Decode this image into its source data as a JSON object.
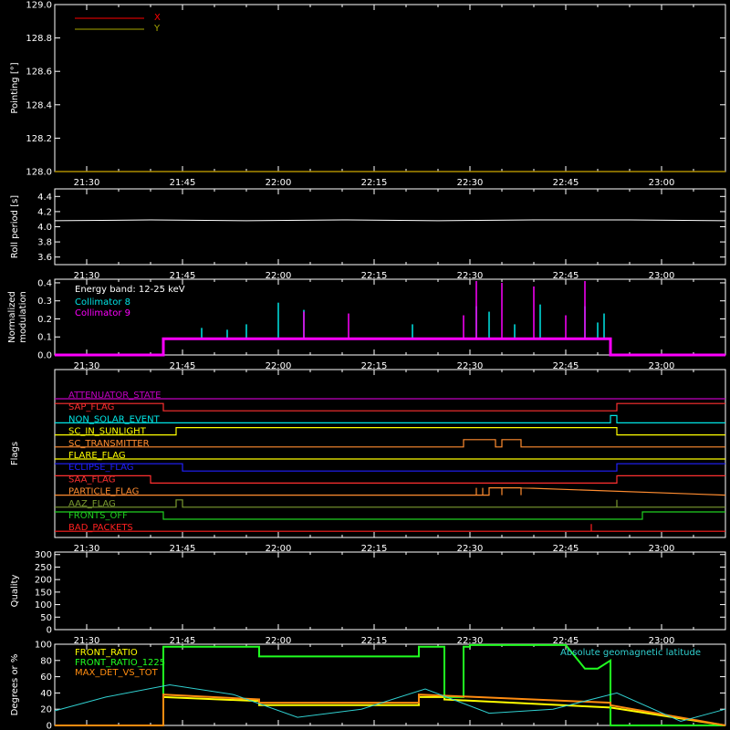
{
  "chart_data": [
    {
      "id": "pointing",
      "type": "line",
      "ylabel": "Pointing [°]",
      "ylim": [
        128.0,
        129.0
      ],
      "yticks": [
        "128.0",
        "128.2",
        "128.4",
        "128.6",
        "128.8",
        "129.0"
      ],
      "legend": [
        "X",
        "Y"
      ],
      "series": [
        {
          "name": "X",
          "color": "#ff0000",
          "x": [
            "21:25",
            "23:10"
          ],
          "y": [
            128.0,
            128.0
          ]
        },
        {
          "name": "Y",
          "color": "#a8a800",
          "x": [
            "21:25",
            "23:10"
          ],
          "y": [
            128.0,
            128.0
          ]
        }
      ]
    },
    {
      "id": "roll",
      "type": "line",
      "ylabel": "Roll period [s]",
      "ylim": [
        3.5,
        4.5
      ],
      "yticks": [
        "3.6",
        "3.8",
        "4.0",
        "4.2",
        "4.4"
      ],
      "series": [
        {
          "name": "",
          "color": "#ffffff",
          "x": [
            "21:25",
            "21:40",
            "21:55",
            "22:10",
            "22:25",
            "22:40",
            "22:55",
            "23:10"
          ],
          "y": [
            4.08,
            4.09,
            4.08,
            4.09,
            4.08,
            4.09,
            4.09,
            4.08
          ]
        }
      ]
    },
    {
      "id": "modulation",
      "type": "line",
      "ylabel": [
        "Normalized",
        "modulation"
      ],
      "ylim": [
        0,
        0.42
      ],
      "yticks": [
        "0.0",
        "0.1",
        "0.2",
        "0.3",
        "0.4"
      ],
      "annotation": "Energy band: 12-25 keV",
      "legend": [
        "Collimator 8",
        "Collimator 9"
      ],
      "series": [
        {
          "name": "Collimator 8",
          "color": "#00e5e5",
          "x": [
            "21:25",
            "21:42",
            "21:42",
            "22:52",
            "22:52",
            "23:10"
          ],
          "y": [
            0.0,
            0.0,
            0.09,
            0.09,
            0.0,
            0.0
          ],
          "spikes": [
            [
              "21:48",
              0.15
            ],
            [
              "21:52",
              0.14
            ],
            [
              "21:55",
              0.17
            ],
            [
              "22:00",
              0.29
            ],
            [
              "22:04",
              0.25
            ],
            [
              "22:21",
              0.17
            ],
            [
              "22:31",
              0.27
            ],
            [
              "22:33",
              0.24
            ],
            [
              "22:37",
              0.17
            ],
            [
              "22:41",
              0.28
            ],
            [
              "22:48",
              0.27
            ],
            [
              "22:50",
              0.18
            ],
            [
              "22:51",
              0.23
            ]
          ]
        },
        {
          "name": "Collimator 9",
          "color": "#ff00ff",
          "x": [
            "21:25",
            "21:42",
            "21:42",
            "22:52",
            "22:52",
            "23:10"
          ],
          "y": [
            0.0,
            0.0,
            0.09,
            0.09,
            0.0,
            0.0
          ],
          "spikes": [
            [
              "22:04",
              0.24
            ],
            [
              "22:11",
              0.23
            ],
            [
              "22:29",
              0.22
            ],
            [
              "22:31",
              0.41
            ],
            [
              "22:35",
              0.4
            ],
            [
              "22:40",
              0.38
            ],
            [
              "22:45",
              0.22
            ],
            [
              "22:48",
              0.41
            ]
          ]
        }
      ]
    },
    {
      "id": "flags",
      "type": "line",
      "ylabel": "Flags",
      "series": [
        {
          "name": "ATTENUATOR_STATE",
          "color": "#c000c0",
          "x": [
            "21:25",
            "23:10"
          ],
          "y": [
            0,
            0
          ]
        },
        {
          "name": "SAP_FLAG",
          "color": "#ff3030",
          "x": [
            "21:25",
            "21:42",
            "21:42",
            "22:53",
            "22:53",
            "23:10"
          ],
          "y": [
            1,
            1,
            0,
            0,
            1,
            1
          ]
        },
        {
          "name": "NON_SOLAR_EVENT",
          "color": "#00e5e5",
          "x": [
            "21:25",
            "22:52",
            "22:52",
            "22:53",
            "22:53",
            "23:10"
          ],
          "y": [
            0,
            0,
            1,
            1,
            0,
            0
          ]
        },
        {
          "name": "SC_IN_SUNLIGHT",
          "color": "#ffff00",
          "x": [
            "21:25",
            "21:44",
            "21:44",
            "22:53",
            "22:53",
            "23:10"
          ],
          "y": [
            0,
            0,
            1,
            1,
            0,
            0
          ]
        },
        {
          "name": "SC_TRANSMITTER",
          "color": "#ff8c30",
          "x": [
            "21:25",
            "22:29",
            "22:29",
            "22:34",
            "22:34",
            "22:35",
            "22:35",
            "22:38",
            "22:38",
            "23:10"
          ],
          "y": [
            0,
            0,
            1,
            1,
            0,
            0,
            1,
            1,
            0,
            0
          ]
        },
        {
          "name": "FLARE_FLAG",
          "color": "#ffff00",
          "x": [
            "21:25",
            "23:10"
          ],
          "y": [
            0,
            0
          ]
        },
        {
          "name": "ECLIPSE_FLAG",
          "color": "#2020ff",
          "x": [
            "21:25",
            "21:45",
            "21:45",
            "22:53",
            "22:53",
            "23:10"
          ],
          "y": [
            1,
            1,
            0,
            0,
            1,
            1
          ]
        },
        {
          "name": "SAA_FLAG",
          "color": "#ff3030",
          "x": [
            "21:25",
            "21:40",
            "21:40",
            "22:53",
            "22:53",
            "23:10"
          ],
          "y": [
            1,
            1,
            0,
            0,
            1,
            1
          ]
        },
        {
          "name": "PARTICLE_FLAG",
          "color": "#ff8c30",
          "x": [
            "21:25",
            "22:31",
            "22:31",
            "22:31",
            "22:31",
            "22:32",
            "22:32",
            "22:32",
            "22:32",
            "22:33",
            "22:33",
            "22:35",
            "22:35",
            "22:35",
            "22:35",
            "22:38",
            "22:38",
            "22:38",
            "22:38",
            "23:10"
          ],
          "y": [
            0,
            0,
            1,
            1,
            0,
            0,
            1,
            1,
            0,
            0,
            1,
            1,
            0,
            0,
            1,
            1,
            0,
            0,
            1,
            0
          ]
        },
        {
          "name": "AAZ_FLAG",
          "color": "#7a9a30",
          "x": [
            "21:25",
            "21:44",
            "21:44",
            "21:45",
            "21:45",
            "22:53",
            "22:53",
            "22:53",
            "22:53",
            "23:10"
          ],
          "y": [
            0,
            0,
            1,
            1,
            0,
            0,
            1,
            1,
            0,
            0
          ]
        },
        {
          "name": "FRONTS_OFF",
          "color": "#20d020",
          "x": [
            "21:25",
            "21:42",
            "21:42",
            "22:57",
            "22:57",
            "23:10"
          ],
          "y": [
            1,
            1,
            0,
            0,
            1,
            1
          ]
        },
        {
          "name": "BAD_PACKETS",
          "color": "#ff2020",
          "x": [
            "21:25",
            "22:49",
            "22:49",
            "22:49",
            "22:49",
            "23:10"
          ],
          "y": [
            0,
            0,
            1,
            1,
            0,
            0
          ]
        }
      ]
    },
    {
      "id": "quality",
      "type": "line",
      "ylabel": "Quality",
      "ylim": [
        0,
        310
      ],
      "yticks": [
        "0",
        "50",
        "100",
        "150",
        "200",
        "250",
        "300"
      ],
      "series": []
    },
    {
      "id": "ratios",
      "type": "line",
      "ylabel": "Degrees or %",
      "ylim": [
        0,
        100
      ],
      "yticks": [
        "0",
        "20",
        "40",
        "60",
        "80",
        "100"
      ],
      "legend": [
        "FRONT_RATIO",
        "FRONT_RATIO_1225",
        "MAX_DET_VS_TOT"
      ],
      "annotation": "Absolute geomagnetic latitude",
      "series": [
        {
          "name": "FRONT_RATIO",
          "color": "#ffff00",
          "x": [
            "21:25",
            "21:42",
            "21:42",
            "21:57",
            "21:57",
            "22:22",
            "22:22",
            "22:26",
            "22:26",
            "22:52",
            "22:52",
            "23:10"
          ],
          "y": [
            0,
            0,
            35,
            30,
            25,
            25,
            35,
            35,
            32,
            22,
            22,
            0
          ]
        },
        {
          "name": "FRONT_RATIO_1225",
          "color": "#20ff20",
          "x": [
            "21:25",
            "21:42",
            "21:42",
            "21:57",
            "21:57",
            "22:22",
            "22:22",
            "22:26",
            "22:26",
            "22:29",
            "22:29",
            "22:30",
            "22:30",
            "22:45",
            "22:48",
            "22:50",
            "22:52",
            "22:52",
            "23:10"
          ],
          "y": [
            0,
            0,
            97,
            97,
            85,
            85,
            97,
            97,
            35,
            35,
            97,
            97,
            99,
            99,
            70,
            70,
            80,
            0,
            0
          ]
        },
        {
          "name": "MAX_DET_VS_TOT",
          "color": "#ff8c10",
          "x": [
            "21:25",
            "21:42",
            "21:42",
            "21:57",
            "21:57",
            "22:22",
            "22:22",
            "22:52",
            "22:52",
            "23:10"
          ],
          "y": [
            0,
            0,
            38,
            32,
            28,
            28,
            38,
            28,
            25,
            0
          ]
        },
        {
          "name": "Absolute geomagnetic latitude",
          "color": "#30d0d0",
          "x": [
            "21:25",
            "21:33",
            "21:43",
            "21:53",
            "22:03",
            "22:13",
            "22:23",
            "22:33",
            "22:43",
            "22:53",
            "23:03",
            "23:10"
          ],
          "y": [
            18,
            35,
            50,
            38,
            10,
            20,
            45,
            15,
            20,
            40,
            5,
            20
          ]
        }
      ]
    }
  ],
  "time_axis": {
    "range": [
      "21:25",
      "23:10"
    ],
    "tick_labels": [
      "21:30",
      "21:45",
      "22:00",
      "22:15",
      "22:30",
      "22:45",
      "23:00"
    ]
  }
}
